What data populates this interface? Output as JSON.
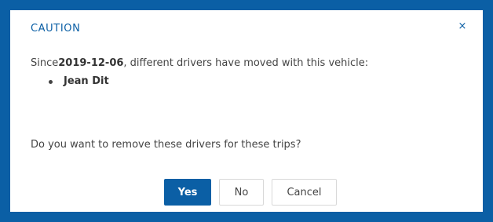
{
  "dialog": {
    "title": "CAUTION",
    "close_label": "×",
    "message_prefix": "Since",
    "date": "2019-12-06",
    "message_suffix": ", different drivers have moved with this vehicle:",
    "drivers": [
      "Jean Dit"
    ],
    "question": "Do you want to remove these drivers for these trips?",
    "buttons": {
      "yes": "Yes",
      "no": "No",
      "cancel": "Cancel"
    }
  },
  "colors": {
    "accent": "#0b5fa5"
  }
}
